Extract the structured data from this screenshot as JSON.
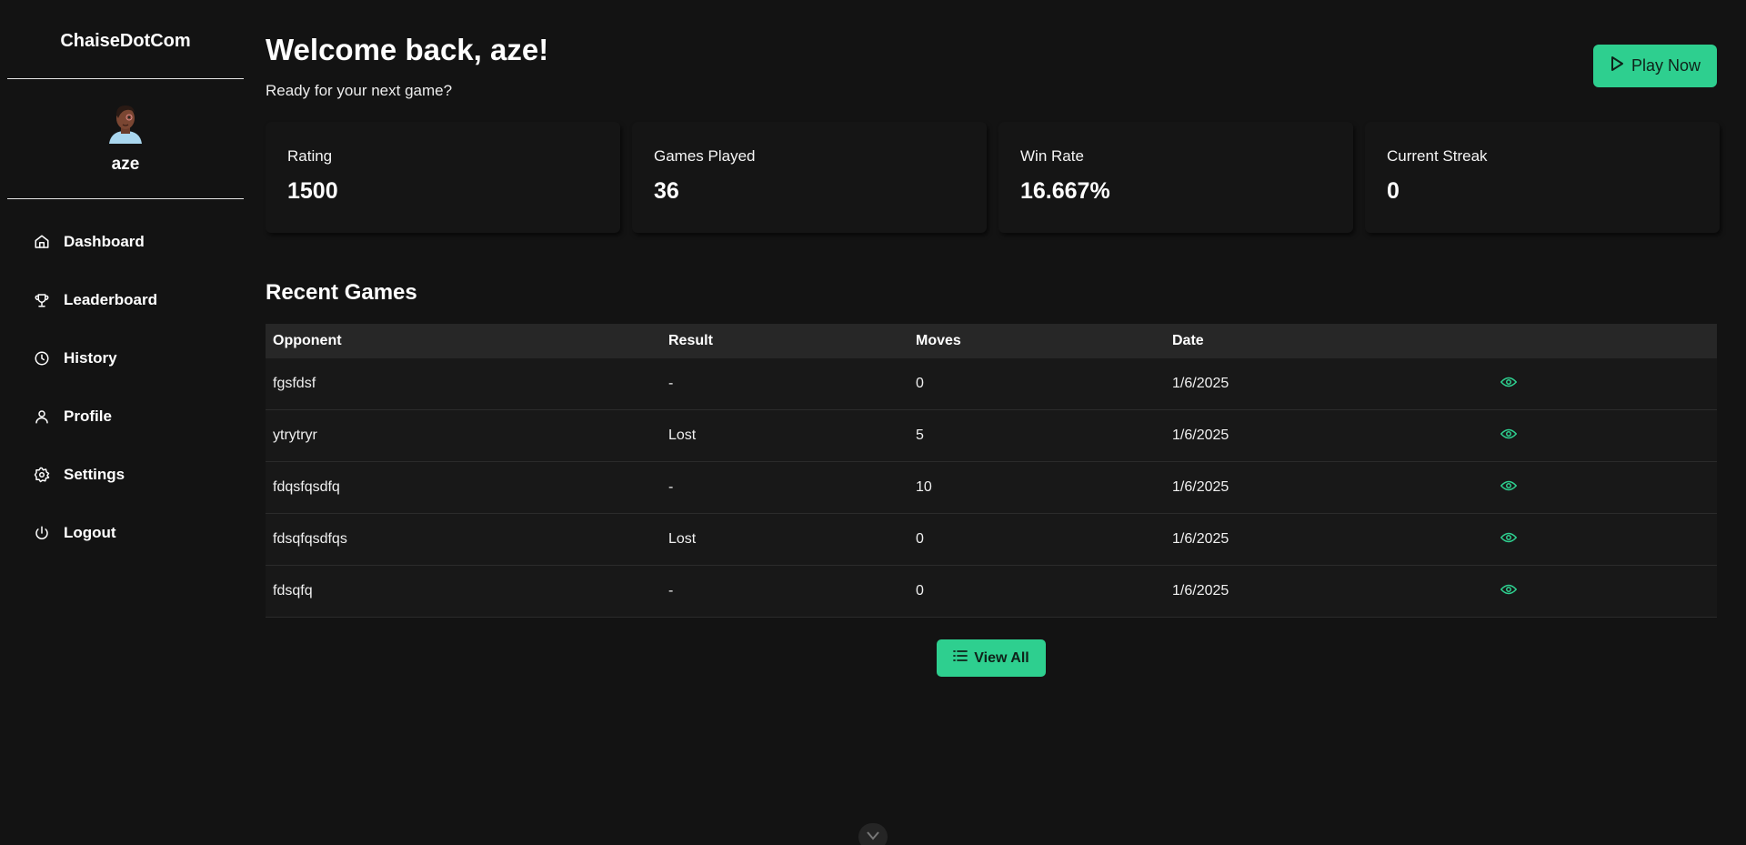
{
  "brand": "ChaiseDotCom",
  "user": {
    "name": "aze"
  },
  "nav": [
    {
      "label": "Dashboard",
      "icon": "home-icon"
    },
    {
      "label": "Leaderboard",
      "icon": "trophy-icon"
    },
    {
      "label": "History",
      "icon": "clock-icon"
    },
    {
      "label": "Profile",
      "icon": "user-icon"
    },
    {
      "label": "Settings",
      "icon": "gear-icon"
    },
    {
      "label": "Logout",
      "icon": "power-icon"
    }
  ],
  "header": {
    "title": "Welcome back, aze!",
    "subtitle": "Ready for your next game?",
    "play_label": "Play Now"
  },
  "stats": [
    {
      "label": "Rating",
      "value": "1500"
    },
    {
      "label": "Games Played",
      "value": "36"
    },
    {
      "label": "Win Rate",
      "value": "16.667%"
    },
    {
      "label": "Current Streak",
      "value": "0"
    }
  ],
  "recent": {
    "title": "Recent Games",
    "columns": [
      "Opponent",
      "Result",
      "Moves",
      "Date"
    ],
    "rows": [
      {
        "opponent": "fgsfdsf",
        "result": "-",
        "moves": "0",
        "date": "1/6/2025"
      },
      {
        "opponent": "ytrytryr",
        "result": "Lost",
        "moves": "5",
        "date": "1/6/2025"
      },
      {
        "opponent": "fdqsfqsdfq",
        "result": "-",
        "moves": "10",
        "date": "1/6/2025"
      },
      {
        "opponent": "fdsqfqsdfqs",
        "result": "Lost",
        "moves": "0",
        "date": "1/6/2025"
      },
      {
        "opponent": "fdsqfq",
        "result": "-",
        "moves": "0",
        "date": "1/6/2025"
      }
    ],
    "view_all_label": "View All"
  },
  "colors": {
    "accent": "#2ecf8f",
    "background": "#131313",
    "header_row": "#272727"
  }
}
